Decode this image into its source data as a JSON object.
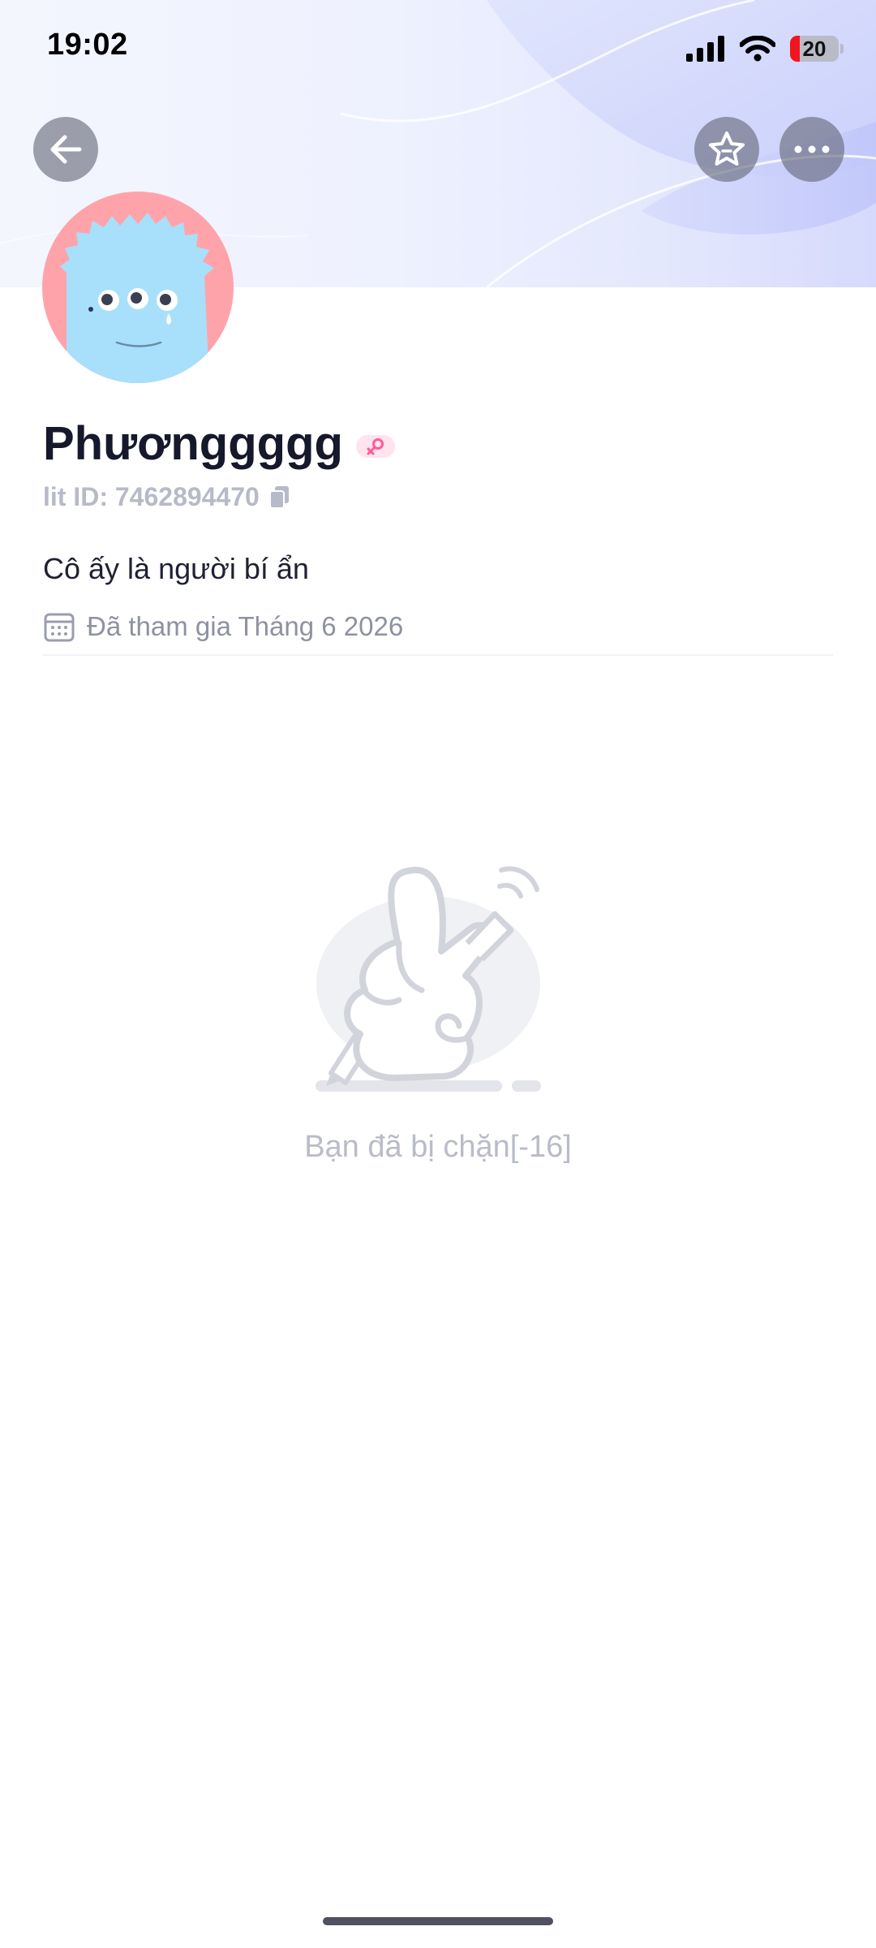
{
  "status_bar": {
    "time": "19:02",
    "battery_level": "20",
    "battery_fraction": 0.2,
    "icons": [
      "cellular-signal-icon",
      "wifi-icon",
      "battery-icon"
    ]
  },
  "header": {
    "back_icon": "arrow-left-icon",
    "favorite_icon": "star-icon",
    "more_icon": "more-horizontal-icon"
  },
  "profile": {
    "name": "Phươnggggg",
    "gender_icon": "female-icon",
    "id_text": "lit ID: 7462894470",
    "copy_icon": "copy-icon",
    "bio": "Cô ấy là người bí ẩn",
    "joined_icon": "calendar-icon",
    "joined": "Đã tham gia Tháng 6 2026"
  },
  "empty_state": {
    "message": "Bạn đã bị chặn[-16]"
  },
  "colors": {
    "avatar_bg": "#ffa3ab",
    "avatar_face": "#a8dffb",
    "badge_pink": "#ff5a9a",
    "muted_text": "#b9bcc8",
    "battery_low": "#f2151d"
  }
}
